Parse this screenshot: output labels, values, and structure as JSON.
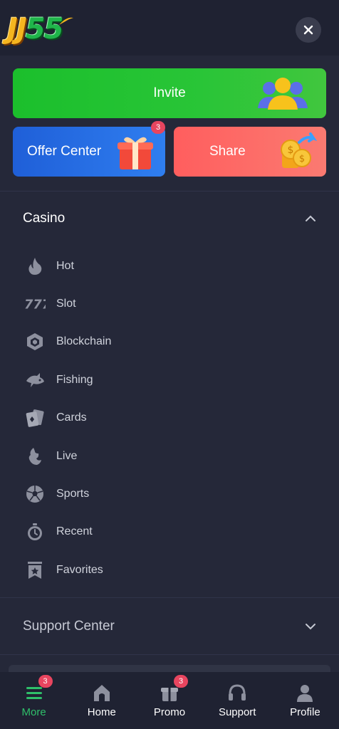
{
  "header": {
    "logo_jj": "JJ",
    "logo_55": "55"
  },
  "promos": {
    "invite_label": "Invite",
    "offer_label": "Offer Center",
    "offer_badge": "3",
    "share_label": "Share"
  },
  "casino": {
    "title": "Casino",
    "expanded": true,
    "items": [
      {
        "label": "Hot",
        "icon": "flame-icon"
      },
      {
        "label": "Slot",
        "icon": "slot-777-icon"
      },
      {
        "label": "Blockchain",
        "icon": "cube-icon"
      },
      {
        "label": "Fishing",
        "icon": "fish-icon"
      },
      {
        "label": "Cards",
        "icon": "cards-icon"
      },
      {
        "label": "Live",
        "icon": "live-dealer-icon"
      },
      {
        "label": "Sports",
        "icon": "soccer-ball-icon"
      },
      {
        "label": "Recent",
        "icon": "stopwatch-icon"
      },
      {
        "label": "Favorites",
        "icon": "bookmark-star-icon"
      }
    ]
  },
  "support": {
    "title": "Support Center",
    "expanded": false
  },
  "tabbar": {
    "tabs": [
      {
        "label": "More",
        "icon": "menu-icon",
        "badge": "3",
        "active": true
      },
      {
        "label": "Home",
        "icon": "home-icon",
        "active": false
      },
      {
        "label": "Promo",
        "icon": "gift-icon",
        "badge": "3",
        "active": false
      },
      {
        "label": "Support",
        "icon": "headset-icon",
        "active": false
      },
      {
        "label": "Profile",
        "icon": "user-icon",
        "active": false
      }
    ]
  },
  "colors": {
    "background": "#252839",
    "header_bg": "#1f2232",
    "invite_green": "#29c537",
    "offer_blue": "#2f7ef0",
    "share_red": "#fb7a71",
    "badge_pink": "#e8455f",
    "active_green": "#2fbf6a"
  }
}
